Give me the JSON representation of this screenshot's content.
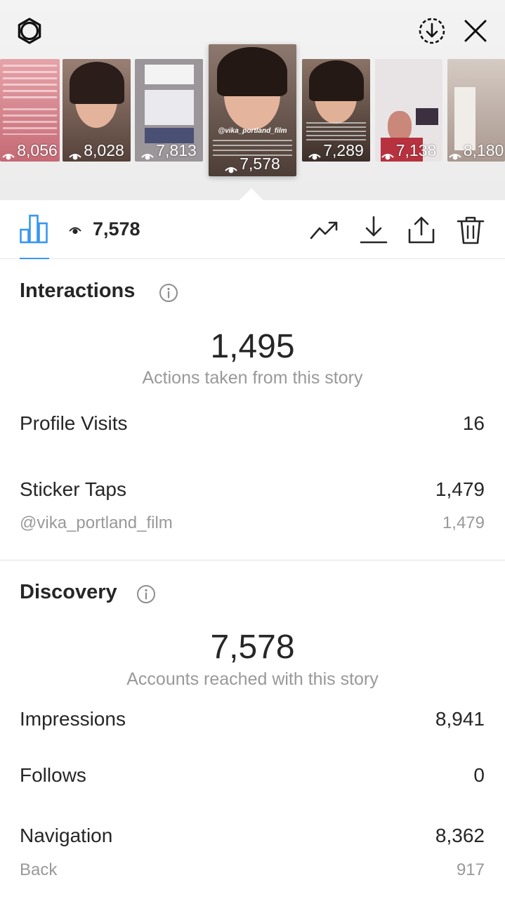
{
  "story_thumbnails": [
    {
      "views": "8,056",
      "bg": "#c8747e"
    },
    {
      "views": "8,028",
      "bg": "#7b6055"
    },
    {
      "views": "7,813",
      "bg": "#8f8a8c"
    },
    {
      "views": "7,578",
      "bg": "#6e5a52",
      "active": true
    },
    {
      "views": "7,289",
      "bg": "#6b5448"
    },
    {
      "views": "7,138",
      "bg": "#c0c0c8"
    },
    {
      "views": "8,180",
      "bg": "#b8aaa3"
    }
  ],
  "active_story_overlay": {
    "username": "@vika_portland_film"
  },
  "toolbar": {
    "view_count": "7,578",
    "icons": [
      "bar-chart-icon",
      "eye-icon",
      "trending-icon",
      "download-icon",
      "share-icon",
      "trash-icon"
    ]
  },
  "interactions": {
    "title": "Interactions",
    "total": "1,495",
    "caption": "Actions taken from this story",
    "rows": [
      {
        "label": "Profile Visits",
        "value": "16"
      },
      {
        "label": "Sticker Taps",
        "value": "1,479"
      }
    ],
    "sticker_detail": {
      "label": "@vika_portland_film",
      "value": "1,479"
    }
  },
  "discovery": {
    "title": "Discovery",
    "total": "7,578",
    "caption": "Accounts reached with this story",
    "rows": [
      {
        "label": "Impressions",
        "value": "8,941"
      },
      {
        "label": "Follows",
        "value": "0"
      },
      {
        "label": "Navigation",
        "value": "8,362"
      }
    ],
    "navigation_detail": {
      "label": "Back",
      "value": "917"
    }
  },
  "colors": {
    "accent": "#3897f0",
    "text": "#262626",
    "secondary": "#999999",
    "divider": "#e0e0e0"
  }
}
